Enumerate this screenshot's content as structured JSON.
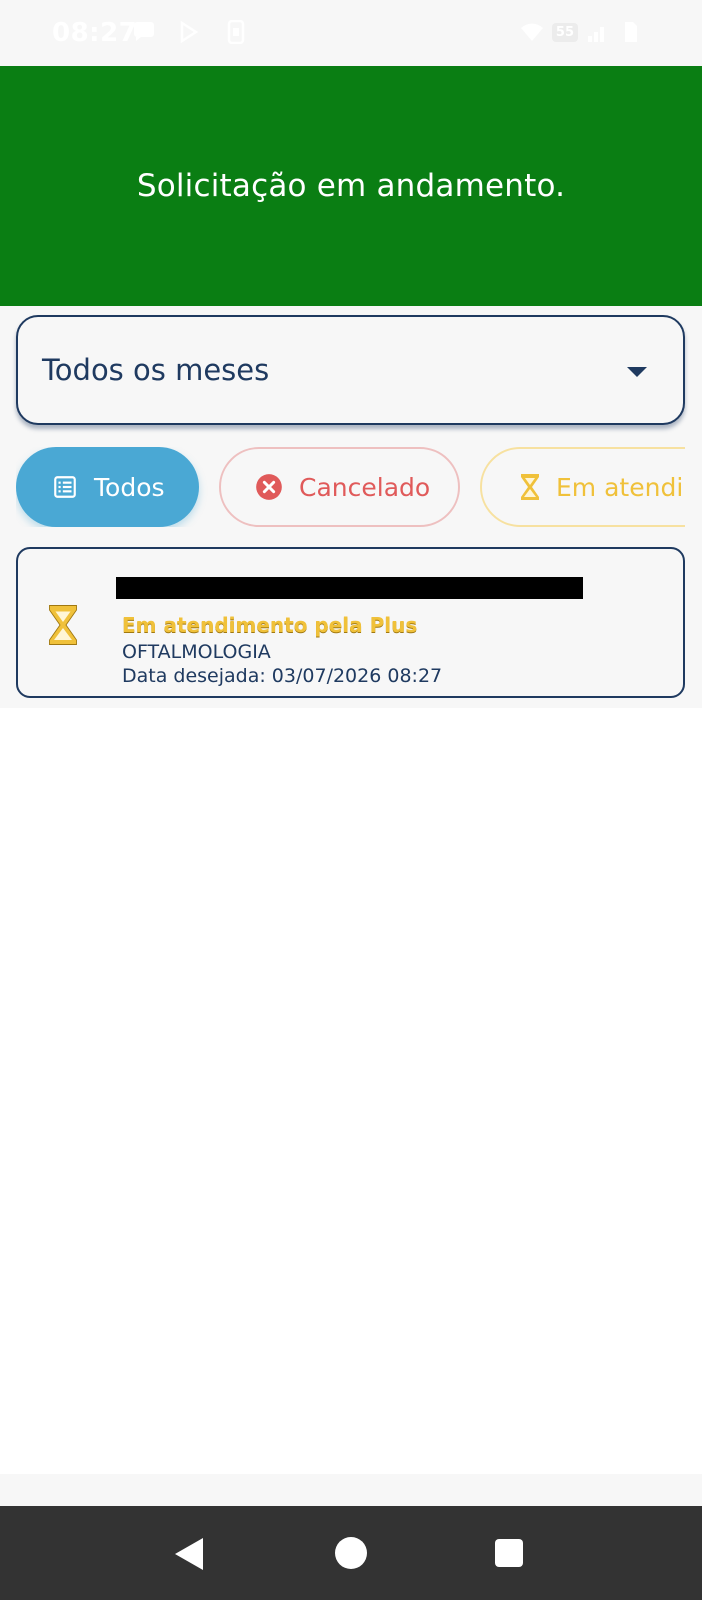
{
  "status_bar": {
    "time": "08:27",
    "battery": "55",
    "icons": [
      "chat-bubble-icon",
      "play-store-icon",
      "phone-screen-icon",
      "wifi-icon",
      "battery-icon",
      "signal-icon",
      "sim-icon"
    ]
  },
  "header": {
    "message": "Solicitação em andamento.",
    "background_color": "#0a7e13"
  },
  "month_filter": {
    "selected": "Todos os meses",
    "icon": "chevron-down-icon"
  },
  "status_filters": [
    {
      "label": "Todos",
      "icon": "list-icon",
      "active": true,
      "color": "#4aa8d4"
    },
    {
      "label": "Cancelado",
      "icon": "cancel-circle-icon",
      "active": false,
      "color": "#e05a5a"
    },
    {
      "label": "Em atendi",
      "icon": "hourglass-icon",
      "active": false,
      "color": "#f0c13a"
    }
  ],
  "requests": [
    {
      "icon": "hourglass-icon",
      "status": "Em atendimento pela Plus",
      "specialty": "OFTALMOLOGIA",
      "date_text": "Data desejada: 03/07/2026 08:27"
    }
  ],
  "nav": {
    "icons": [
      "back-icon",
      "home-icon",
      "recents-icon"
    ]
  }
}
